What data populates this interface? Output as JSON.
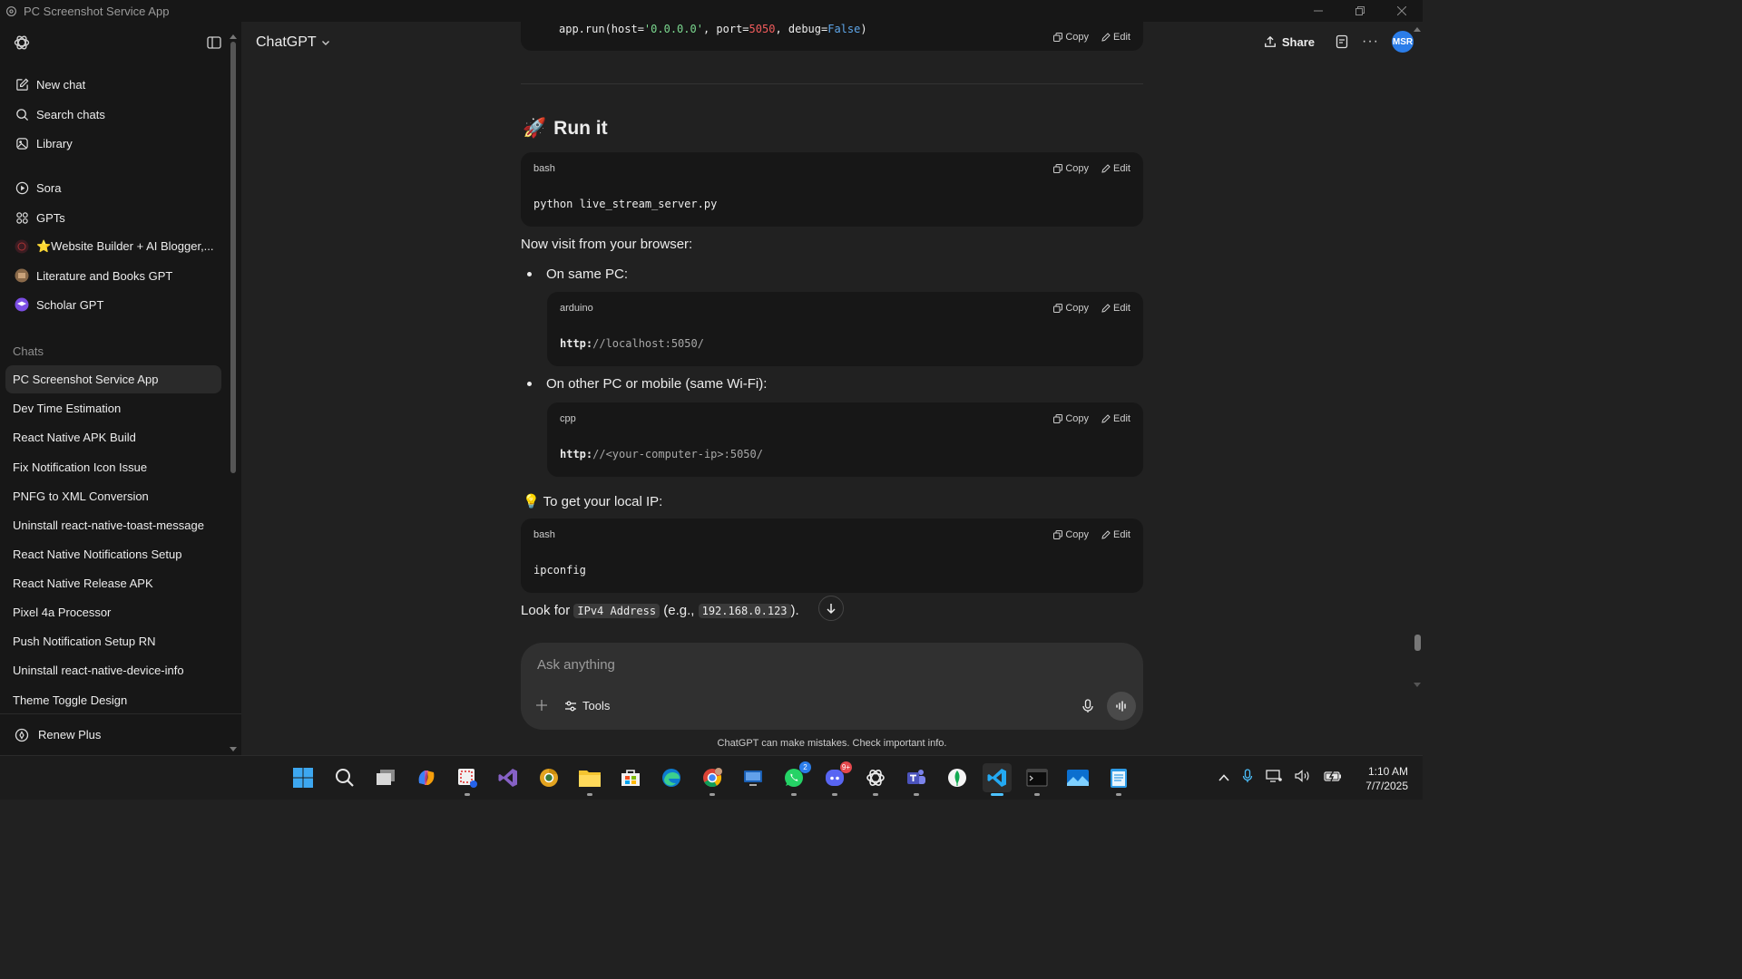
{
  "window": {
    "title": "PC Screenshot Service App"
  },
  "sidebar": {
    "nav": [
      {
        "label": "New chat",
        "icon": "edit-icon"
      },
      {
        "label": "Search chats",
        "icon": "search-icon"
      },
      {
        "label": "Library",
        "icon": "library-icon"
      }
    ],
    "apps": [
      {
        "label": "Sora",
        "icon": "sora-icon"
      },
      {
        "label": "GPTs",
        "icon": "grid-icon"
      },
      {
        "label": "⭐Website Builder + AI Blogger,...",
        "icon": "gpt-avatar"
      },
      {
        "label": "Literature and Books GPT",
        "icon": "gpt-avatar"
      },
      {
        "label": "Scholar GPT",
        "icon": "gpt-avatar"
      }
    ],
    "chats_label": "Chats",
    "chats": [
      "PC Screenshot Service App",
      "Dev Time Estimation",
      "React Native APK Build",
      "Fix Notification Icon Issue",
      "PNFG to XML Conversion",
      "Uninstall react-native-toast-message",
      "React Native Notifications Setup",
      "React Native Release APK",
      "Pixel 4a Processor",
      "Push Notification Setup RN",
      "Uninstall react-native-device-info",
      "Theme Toggle Design"
    ],
    "renew_label": "Renew Plus"
  },
  "header": {
    "model": "ChatGPT",
    "share": "Share",
    "avatar": "MSR"
  },
  "content": {
    "top_code": {
      "prefix": "app.run(host=",
      "host": "'0.0.0.0'",
      "mid": ", port=",
      "port": "5050",
      "mid2": ", debug=",
      "debug": "False",
      "suffix": ")"
    },
    "copy_label": "Copy",
    "edit_label": "Edit",
    "heading_emoji": "🚀",
    "heading": "Run it",
    "block1": {
      "lang": "bash",
      "code": "python live_stream_server.py"
    },
    "visit_text": "Now visit from your browser:",
    "bullet1": "On same PC:",
    "block2": {
      "lang": "arduino",
      "proto": "http:",
      "rest": "//localhost:5050/"
    },
    "bullet2": "On other PC or mobile (same Wi-Fi):",
    "block3": {
      "lang": "cpp",
      "proto": "http:",
      "rest": "//<your-computer-ip>:5050/"
    },
    "tip_emoji": "💡",
    "tip_text": "To get your local IP:",
    "block4": {
      "lang": "bash",
      "code": "ipconfig"
    },
    "look_prefix": "Look for ",
    "look_code1": "IPv4 Address",
    "look_mid": " (e.g., ",
    "look_code2": "192.168.0.123",
    "look_suffix": ")."
  },
  "composer": {
    "placeholder": "Ask anything",
    "tools": "Tools"
  },
  "disclaimer": "ChatGPT can make mistakes. Check important info.",
  "taskbar": {
    "apps": [
      "start",
      "search",
      "task-view",
      "copilot",
      "snipping-tool",
      "visual-studio",
      "chrome-canary",
      "file-explorer",
      "microsoft-store",
      "edge",
      "chrome",
      "remote-desktop",
      "whatsapp",
      "discord",
      "chatgpt",
      "teams",
      "mongodb-compass",
      "vscode",
      "terminal",
      "photos",
      "notepad"
    ],
    "badges": {
      "whatsapp": "2",
      "discord": "9+"
    },
    "time": "1:10 AM",
    "date": "7/7/2025"
  },
  "colors": {
    "accent": "#2b7de9",
    "string": "#7bd88f",
    "number": "#f25c5c",
    "boolean": "#5ea6e9"
  }
}
